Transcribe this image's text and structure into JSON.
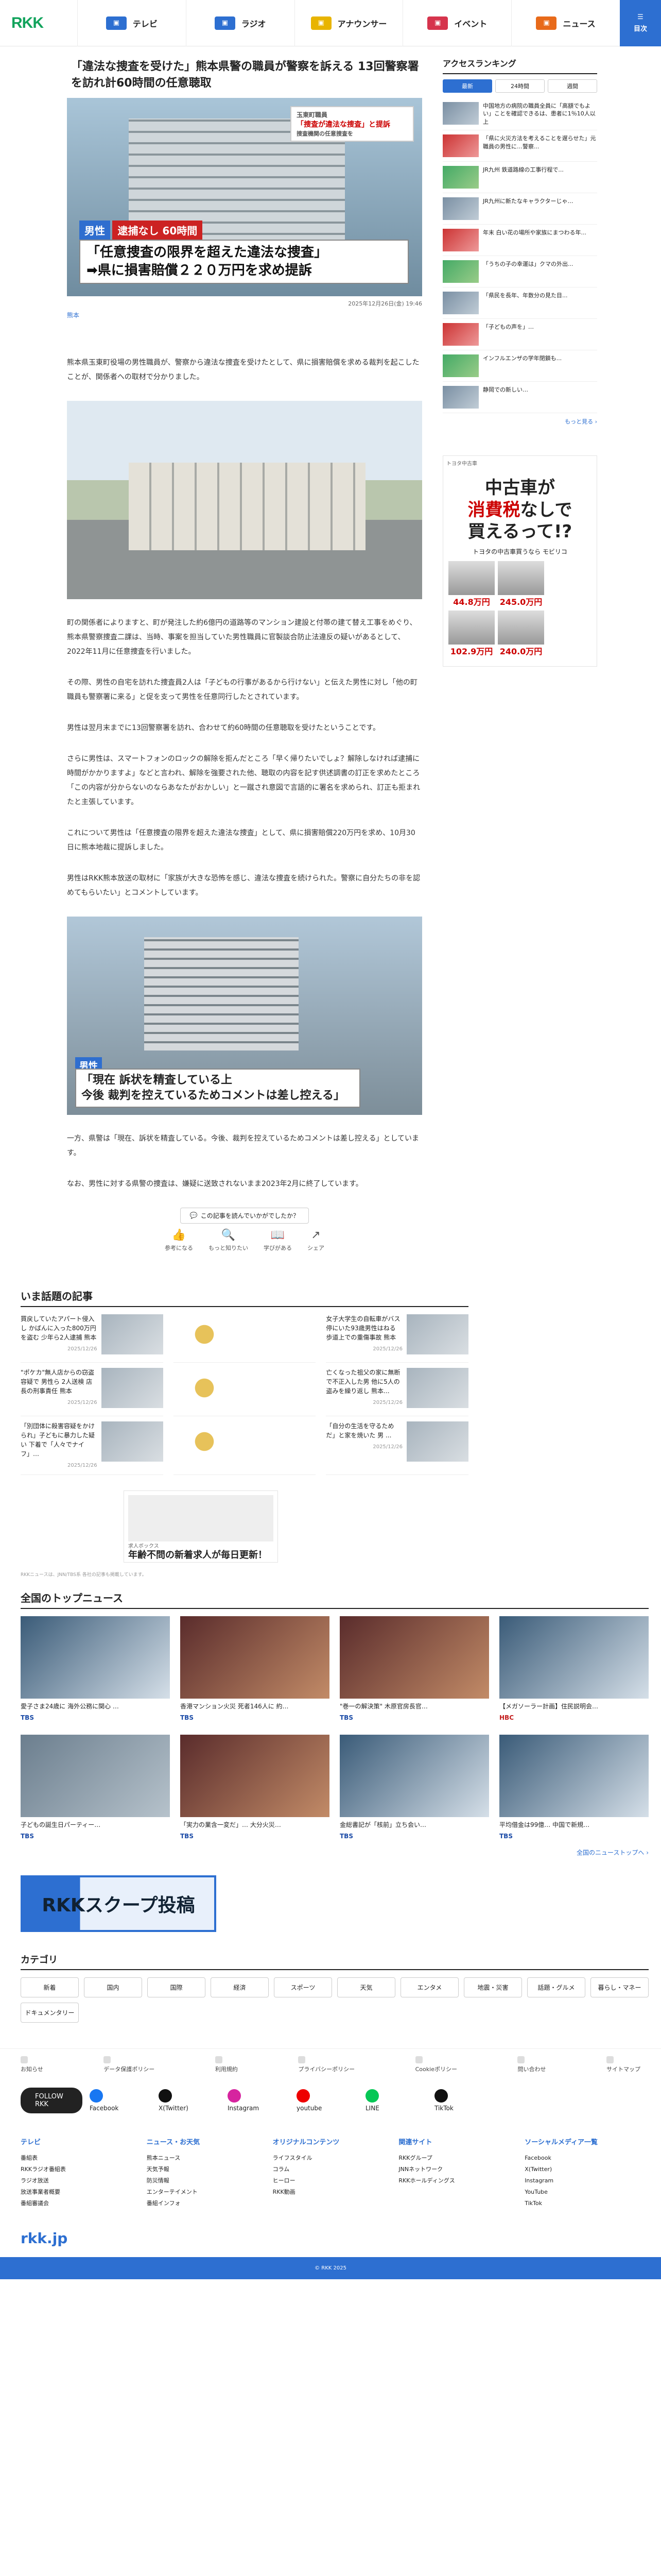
{
  "header": {
    "logo": "RKK",
    "nav": [
      {
        "label": "テレビ",
        "color": "#2d6fd1"
      },
      {
        "label": "ラジオ",
        "color": "#2d6fd1"
      },
      {
        "label": "アナウンサー",
        "color": "#e8b400"
      },
      {
        "label": "イベント",
        "color": "#d6344d"
      },
      {
        "label": "ニュース",
        "color": "#e86a1a"
      }
    ],
    "bookmark": "目次"
  },
  "article": {
    "title": "「違法な捜査を受けた」熊本県警の職員が警察を訴える 13回警察署を訪れ計60時間の任意聴取",
    "hero": {
      "tag_top": "玉東町職員",
      "tag_title": "「捜査が違法な捜査」と提訴",
      "tag_sub": "捜査機関の任意捜査を",
      "label1": "男性",
      "label2": "逮捕なし 60時間",
      "caption": "「任意捜査の限界を超えた違法な捜査」\n➡県に損害賠償２２０万円を求め提訴"
    },
    "date": "2025年12月26日(金) 19:46",
    "credit": "熊本",
    "p1": "熊本県玉東町役場の男性職員が、警察から違法な捜査を受けたとして、県に損害賠償を求める裁判を起こしたことが、関係者への取材で分かりました。",
    "p2": "町の関係者によりますと、町が発注した約6億円の道路等のマンション建設と付帯の建て替え工事をめぐり、熊本県警察捜査二課は、当時、事案を担当していた男性職員に官製談合防止法違反の疑いがあるとして、2022年11月に任意捜査を行いました。",
    "p3": "その際、男性の自宅を訪れた捜査員2人は「子どもの行事があるから行けない」と伝えた男性に対し「他の町職員も警察署に来る」と促を支って男性を任意同行したとされています。",
    "p4": "男性は翌月末までに13回警察署を訪れ、合わせて約60時間の任意聴取を受けたということです。",
    "p5": "さらに男性は、スマートフォンのロックの解除を拒んだところ「早く帰りたいでしょ？解除しなければ逮捕に時間がかかりますよ」などと言われ、解除を強要された他、聴取の内容を記す供述調書の訂正を求めたところ「この内容が分からないのならあなたがおかしい」と一蹴され意図で言語的に署名を求められ、訂正も拒まれたと主張しています。",
    "p6": "これについて男性は「任意捜査の限界を超えた違法な捜査」として、県に損害賠償220万円を求め、10月30日に熊本地裁に提訴しました。",
    "p7": "男性はRKK熊本放送の取材に「家族が大きな恐怖を感じ、違法な捜査を続けられた。警察に自分たちの非を認めてもらいたい」とコメントしています。",
    "pic2": {
      "label": "男性",
      "caption": "「現在 訴状を精査している上\n今後 裁判を控えているためコメントは差し控える」"
    },
    "p8": "一方、県警は「現在、訴状を精査している。今後、裁判を控えているためコメントは差し控える」としています。",
    "p9": "なお、男性に対する県警の捜査は、嫌疑に送致されないまま2023年2月に終了しています。",
    "feedback": "この記事を読んでいかがでしたか？",
    "reactions": [
      "参考になる",
      "もっと知りたい",
      "学びがある",
      "シェア"
    ]
  },
  "ranking": {
    "title": "アクセスランキング",
    "tabs": [
      "最新",
      "24時間",
      "週間"
    ],
    "items": [
      "中国地方の病院の職員全員に「高額でもよい」ことを確認できるは、患者に1％10人以上",
      "「県に火災方法を考えることを遅らせた」元職員の男性に…警察...",
      "JR九州 鉄道路線の工事行程で...",
      "JR九州に新たなキャラクターじゃ…",
      "年末 白い花の場所や家族にまつわる年...",
      "「うちの子の幸運は」クマの外出...",
      "「県民を長年、年数分の見た目...",
      "「子どもの声を」…",
      "インフルエンザの学年閉鎖も...",
      "静岡での新しい…"
    ],
    "more": "もっと見る ›"
  },
  "ad": {
    "header": "トヨタ中古車",
    "title1": "中古車が",
    "title2": "消費税",
    "title3": "なしで",
    "title4": "買えるって!?",
    "brand": "トヨタの中古車買うなら モビリコ",
    "prices": [
      "44.8万円",
      "245.0万円",
      "102.9万円",
      "240.0万円"
    ]
  },
  "topics": {
    "title": "いま話題の記事",
    "items": [
      {
        "text": "買戻していたアパート侵入し かばんに入った800万円を盗む 少年ら2人逮捕 熊本",
        "date": "2025/12/26"
      },
      {
        "text": "",
        "date": ""
      },
      {
        "text": "女子大学生の自転車がバス停にいた93歳男性はねる 歩道上での重傷事故 熊本",
        "date": "2025/12/26"
      },
      {
        "text": "\"ポケカ\"無人店からの窃盗容疑で 男性ら 2人送検 店長の刑事責任 熊本",
        "date": "2025/12/26"
      },
      {
        "text": "",
        "date": ""
      },
      {
        "text": "亡くなった祖父の家に無断で不正入した男 他に5人の盗みを繰り返し 熊本...",
        "date": "2025/12/26"
      },
      {
        "text": "「別団体に殺害容疑をかけられ」子どもに暴力した疑い 下着で「人々でナイフ」…",
        "date": "2025/12/26"
      },
      {
        "text": "",
        "date": ""
      },
      {
        "text": "「自分の生活を守るためだ」と家を焼いた 男 ...",
        "date": "2025/12/26"
      }
    ]
  },
  "smallad": {
    "sponsor": "求人ボックス",
    "title": "年齢不問の新着求人が毎日更新！"
  },
  "note": "RKKニュースは、JNN/TBS系 各社の記事も掲載しています。",
  "national": {
    "title": "全国のトップニュース",
    "items": [
      {
        "text": "愛子さま24歳に 海外公務に関心 …",
        "src": "TBS",
        "cls": "tbs",
        "img": "c"
      },
      {
        "text": "香港マンション火災 死者146人に 約…",
        "src": "TBS",
        "cls": "tbs",
        "img": "d"
      },
      {
        "text": "\"巻一の解決策\" 木原官房長官…",
        "src": "TBS",
        "cls": "tbs",
        "img": "d"
      },
      {
        "text": "【メガソーラー計画】住民説明会…",
        "src": "HBC",
        "cls": "hbc",
        "img": "c"
      },
      {
        "text": "子どもの誕生日パーティー…",
        "src": "TBS",
        "cls": "tbs",
        "img": ""
      },
      {
        "text": "「実力の業含一変だ」… 大分火災…",
        "src": "TBS",
        "cls": "tbs",
        "img": "d"
      },
      {
        "text": "金総書記が「核前」立ち会い…",
        "src": "TBS",
        "cls": "tbs",
        "img": "c"
      },
      {
        "text": "平均借金は99億… 中国で新規…",
        "src": "TBS",
        "cls": "tbs",
        "img": "c"
      }
    ],
    "more": "全国のニューストップへ ›"
  },
  "scoop": "RKKスクープ投稿",
  "categories": {
    "title": "カテゴリ",
    "items": [
      "新着",
      "国内",
      "国際",
      "経済",
      "スポーツ",
      "天気",
      "エンタメ",
      "地震・災害",
      "話題・グルメ",
      "暮らし・マネー",
      "ドキュメンタリー"
    ]
  },
  "util": [
    "お知らせ",
    "データ保護ポリシー",
    "利用規約",
    "プライバシーポリシー",
    "Cookieポリシー",
    "問い合わせ",
    "サイトマップ"
  ],
  "social": {
    "follow": "FOLLOW RKK",
    "items": [
      {
        "label": "Facebook",
        "color": "#1877f2"
      },
      {
        "label": "X(Twitter)",
        "color": "#111"
      },
      {
        "label": "Instagram",
        "color": "#d6249f"
      },
      {
        "label": "youtube",
        "color": "#e00"
      },
      {
        "label": "LINE",
        "color": "#06c755"
      },
      {
        "label": "TikTok",
        "color": "#111"
      }
    ]
  },
  "footer": [
    {
      "h": "テレビ",
      "items": [
        "番組表",
        "RKKラジオ番組表",
        "ラジオ放送",
        "放送事業者概要",
        "番組審議会"
      ]
    },
    {
      "h": "ニュース・お天気",
      "items": [
        "熊本ニュース",
        "天気予報",
        "防災情報",
        "エンターテイメント",
        "番組インフォ"
      ]
    },
    {
      "h": "オリジナルコンテンツ",
      "items": [
        "ライフスタイル",
        "コラム",
        "ヒーロー",
        "RKK動画"
      ]
    },
    {
      "h": "関連サイト",
      "items": [
        "RKKグループ",
        "JNNネットワーク",
        "RKKホールディングス"
      ]
    },
    {
      "h": "ソーシャルメディア一覧",
      "items": [
        "Facebook",
        "X(Twitter)",
        "Instagram",
        "YouTube",
        "TikTok"
      ]
    }
  ],
  "flogo": "rkk.jp",
  "copyright": "© RKK 2025"
}
